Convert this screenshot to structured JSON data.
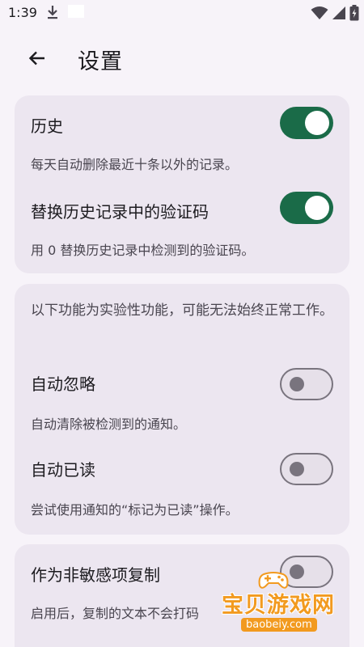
{
  "status_bar": {
    "time": "1:39",
    "icons": [
      "download-icon",
      "wifi-icon",
      "signal-icon",
      "battery-icon"
    ]
  },
  "app_bar": {
    "back_icon": "arrow-left-icon",
    "title": "设置"
  },
  "card1": {
    "history": {
      "title": "历史",
      "subtitle": "每天自动删除最近十条以外的记录。",
      "enabled": true
    },
    "replace_code": {
      "title": "替换历史记录中的验证码",
      "subtitle": "用 0 替换历史记录中检测到的验证码。",
      "enabled": true
    }
  },
  "card2": {
    "notice": "以下功能为实验性功能，可能无法始终正常工作。",
    "auto_ignore": {
      "title": "自动忽略",
      "subtitle": "自动清除被检测到的通知。",
      "enabled": false
    },
    "auto_read": {
      "title": "自动已读",
      "subtitle": "尝试使用通知的“标记为已读”操作。",
      "enabled": false
    }
  },
  "card3": {
    "copy_non_sensitive": {
      "title": "作为非敏感项复制",
      "subtitle": "启用后，复制的文本不会打码",
      "enabled": false
    }
  },
  "watermark": {
    "text": "宝贝游戏网",
    "url": "baobeiy.com"
  },
  "colors": {
    "background": "#f7f3f9",
    "card": "#ece6f0",
    "switch_on": "#1a6b48",
    "switch_off_outline": "#79747e",
    "watermark": "#f29a1f"
  }
}
